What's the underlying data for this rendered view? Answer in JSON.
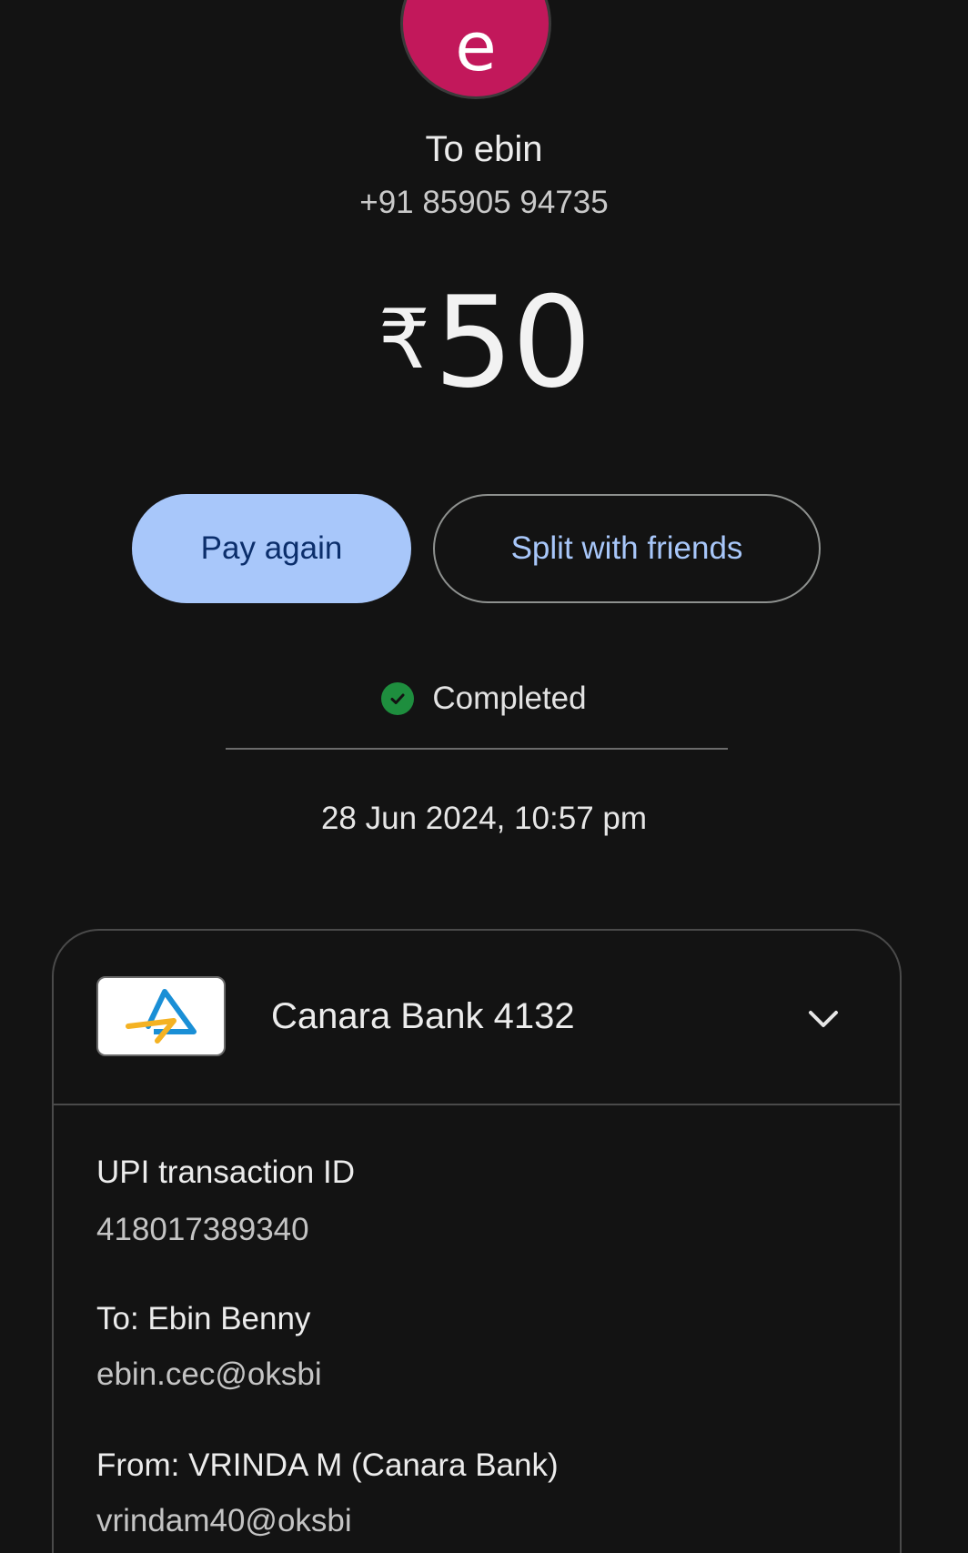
{
  "recipient": {
    "avatar_letter": "e",
    "avatar_color": "#c2185b",
    "name": "To ebin",
    "phone": "+91 85905 94735"
  },
  "amount": {
    "currency": "₹",
    "value": "50"
  },
  "actions": {
    "pay_again": "Pay again",
    "split": "Split with friends"
  },
  "status": {
    "text": "Completed",
    "icon": "check-circle-icon",
    "color": "#1e8e3e"
  },
  "datetime": "28 Jun 2024, 10:57 pm",
  "payment_card": {
    "bank_icon": "canara-bank-logo",
    "bank_name": "Canara Bank 4132",
    "expand_icon": "chevron-down-icon",
    "details": [
      {
        "label": "UPI transaction ID",
        "value": "418017389340"
      },
      {
        "label": "To: Ebin  Benny",
        "value": "ebin.cec@oksbi"
      },
      {
        "label": "From: VRINDA M (Canara Bank)",
        "value": "vrindam40@oksbi"
      }
    ]
  },
  "colors": {
    "background": "#131313",
    "accent": "#a8c7fa"
  }
}
